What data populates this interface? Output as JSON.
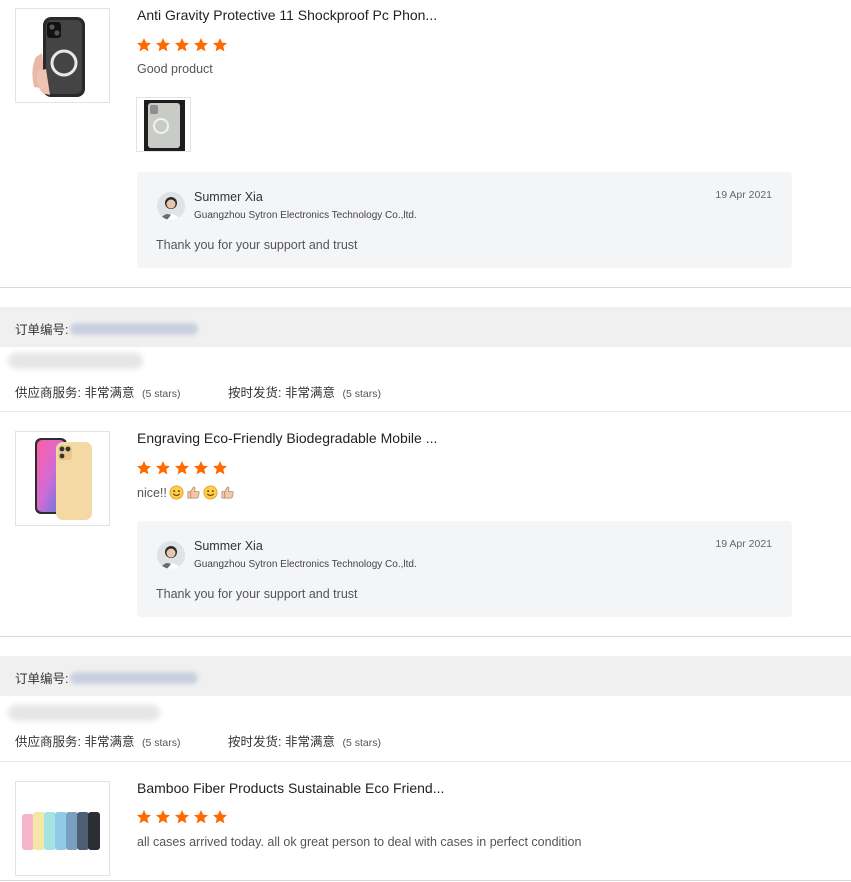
{
  "colors": {
    "star": "#ff6a00",
    "reply_bg": "#f4f5f7",
    "order_bar": "#f0f0f0"
  },
  "reviews": [
    {
      "title": "Anti Gravity Protective 11 Shockproof Pc Phon...",
      "stars": 5,
      "comment": "Good product",
      "image_icon": "clear-magsafe-phone-case",
      "photo_icon": "customer-photo-clear-case",
      "reply": {
        "name": "Summer Xia",
        "company": "Guangzhou Sytron Electronics Technology Co.,ltd.",
        "date": "19 Apr 2021",
        "text": "Thank you for your support and trust"
      }
    },
    {
      "title": "Engraving Eco-Friendly Biodegradable Mobile ...",
      "stars": 5,
      "comment": "nice!!",
      "comment_emojis": [
        "smile-emoji",
        "thumbs-up-emoji",
        "smile-emoji",
        "thumbs-up-emoji"
      ],
      "image_icon": "biodegradable-phone-case",
      "reply": {
        "name": "Summer Xia",
        "company": "Guangzhou Sytron Electronics Technology Co.,ltd.",
        "date": "19 Apr 2021",
        "text": "Thank you for your support and trust"
      }
    },
    {
      "title": "Bamboo Fiber Products Sustainable Eco Friend...",
      "stars": 5,
      "comment": "all cases arrived today. all ok great person to deal with cases in perfect condition",
      "image_icon": "bamboo-fiber-phone-cases"
    }
  ],
  "orders": [
    {
      "order_label": "订单编号:",
      "supplier_service_label": "供应商服务:",
      "supplier_service_value": "非常满意",
      "supplier_service_stars": "(5 stars)",
      "on_time_label": "按时发货:",
      "on_time_value": "非常满意",
      "on_time_stars": "(5 stars)"
    },
    {
      "order_label": "订单编号:",
      "supplier_service_label": "供应商服务:",
      "supplier_service_value": "非常满意",
      "supplier_service_stars": "(5 stars)",
      "on_time_label": "按时发货:",
      "on_time_value": "非常满意",
      "on_time_stars": "(5 stars)"
    }
  ]
}
